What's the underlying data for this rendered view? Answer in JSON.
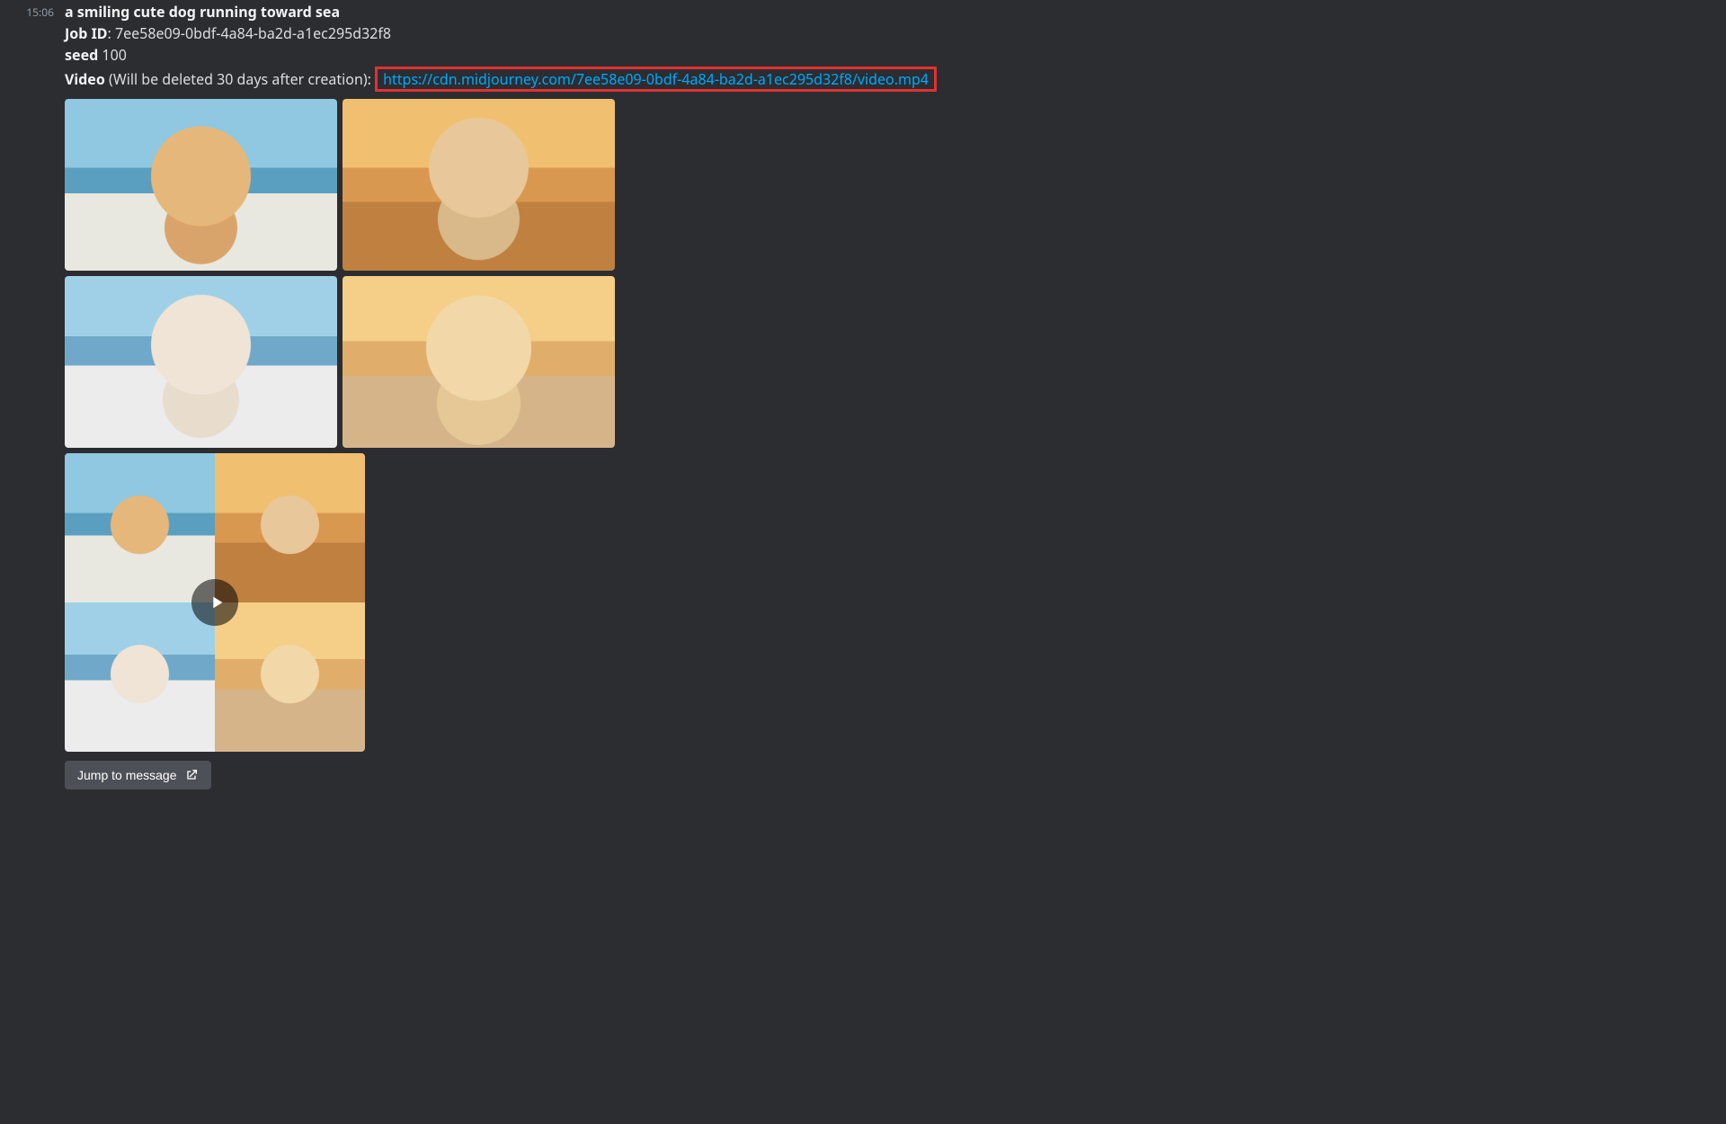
{
  "timestamp": "15:06",
  "prompt": "a smiling cute dog running toward sea",
  "job_id_label": "Job ID",
  "job_id": "7ee58e09-0bdf-4a84-ba2d-a1ec295d32f8",
  "seed_label": "seed",
  "seed": "100",
  "video_label": "Video",
  "video_note": "(Will be deleted 30 days after creation):",
  "video_url": "https://cdn.midjourney.com/7ee58e09-0bdf-4a84-ba2d-a1ec295d32f8/video.mp4",
  "jump_label": "Jump to message"
}
